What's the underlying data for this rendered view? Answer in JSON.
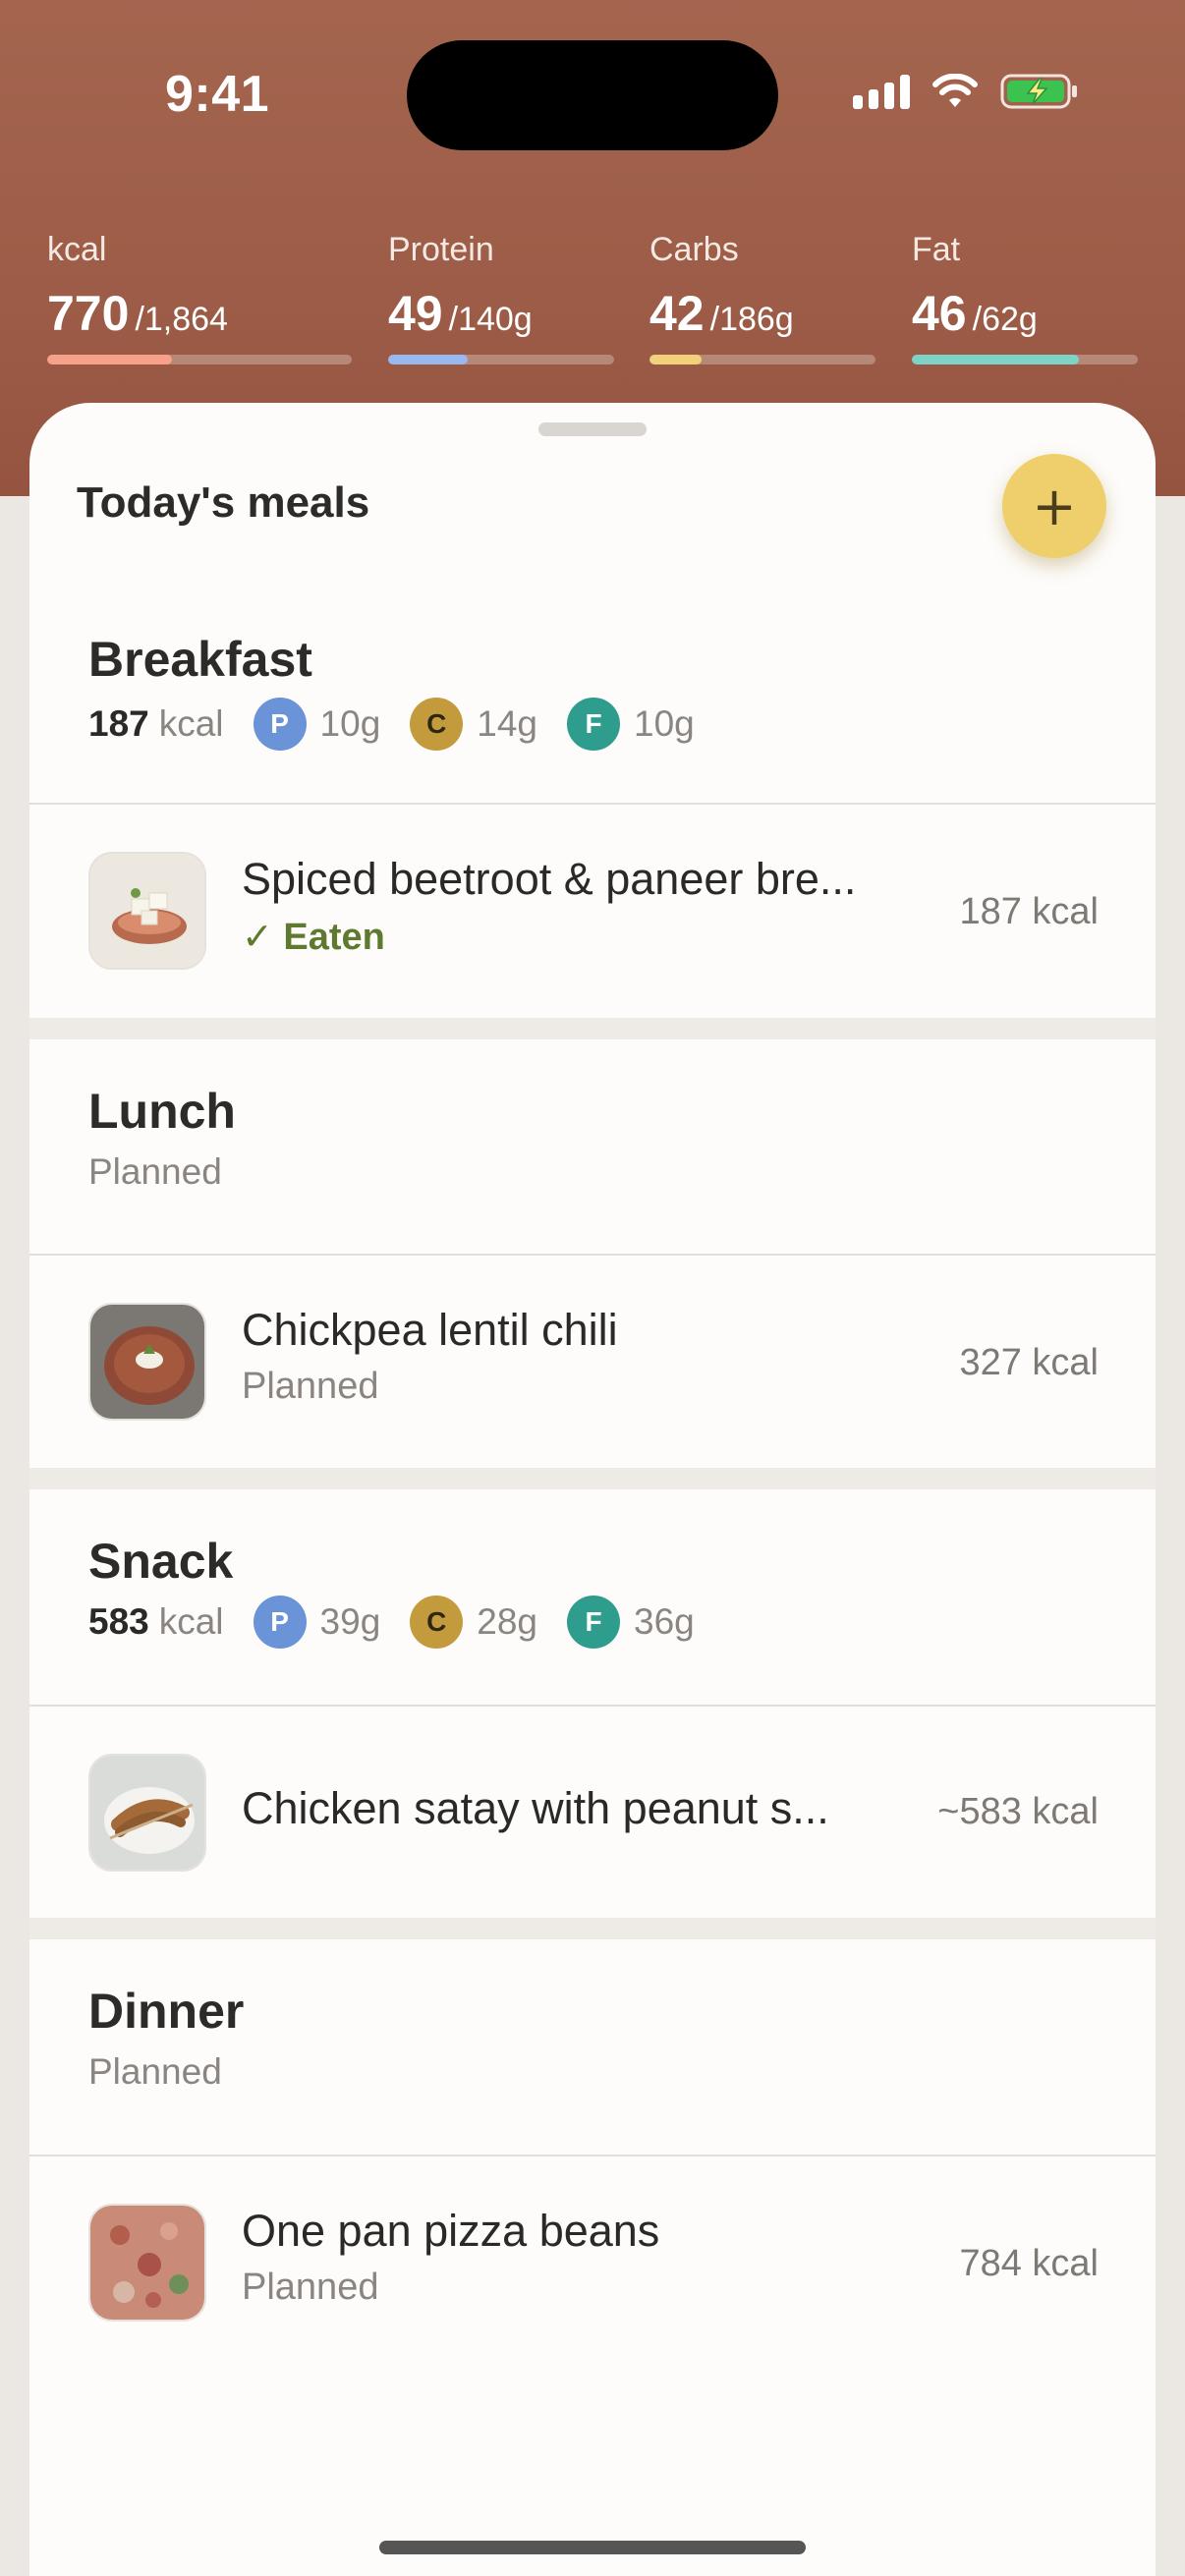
{
  "status_bar": {
    "time": "9:41"
  },
  "macros": [
    {
      "label": "kcal",
      "value": "770",
      "target": "/1,864",
      "progress": 0.41,
      "color": "#f7a08a"
    },
    {
      "label": "Protein",
      "value": "49",
      "target": "/140g",
      "progress": 0.35,
      "color": "#9ab8f0"
    },
    {
      "label": "Carbs",
      "value": "42",
      "target": "/186g",
      "progress": 0.23,
      "color": "#f1d27a"
    },
    {
      "label": "Fat",
      "value": "46",
      "target": "/62g",
      "progress": 0.74,
      "color": "#7dd3c5"
    }
  ],
  "sheet": {
    "title": "Today's meals",
    "add_icon": "+"
  },
  "meals": [
    {
      "name": "Breakfast",
      "kcal": "187",
      "kcal_label": "kcal",
      "protein": "10g",
      "carbs": "14g",
      "fat": "10g",
      "item": {
        "title": "Spiced beetroot & paneer bre...",
        "status": "✓ Eaten",
        "kcal": "187 kcal",
        "icon": "paneer-dish-thumb"
      }
    },
    {
      "name": "Lunch",
      "status": "Planned",
      "item": {
        "title": "Chickpea lentil chili",
        "status": "Planned",
        "kcal": "327 kcal",
        "icon": "chili-bowl-thumb"
      }
    },
    {
      "name": "Snack",
      "kcal": "583",
      "kcal_label": "kcal",
      "protein": "39g",
      "carbs": "28g",
      "fat": "36g",
      "item": {
        "title": "Chicken satay with peanut s...",
        "kcal": "~583 kcal",
        "icon": "satay-plate-thumb"
      }
    },
    {
      "name": "Dinner",
      "status": "Planned",
      "item": {
        "title": "One pan pizza beans",
        "status": "Planned",
        "kcal": "784 kcal",
        "icon": "pizza-beans-thumb"
      }
    }
  ],
  "badges": {
    "p": "P",
    "c": "C",
    "f": "F"
  }
}
